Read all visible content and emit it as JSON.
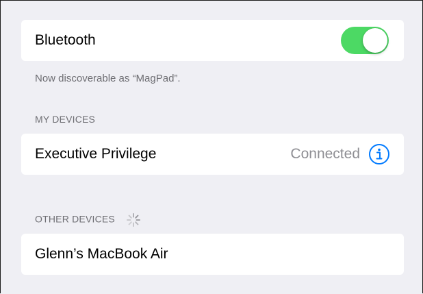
{
  "bluetooth": {
    "label": "Bluetooth",
    "enabled": true,
    "discoverable_note": "Now discoverable as “MagPad”."
  },
  "my_devices": {
    "header": "MY DEVICES",
    "items": [
      {
        "name": "Executive Privilege",
        "status": "Connected",
        "icon": "info-icon"
      }
    ]
  },
  "other_devices": {
    "header": "OTHER DEVICES",
    "loading_icon": "spinner-icon",
    "items": [
      {
        "name": "Glenn’s MacBook Air"
      }
    ]
  },
  "colors": {
    "toggle_on": "#4cd964",
    "accent": "#007aff",
    "background": "#efeff4",
    "secondary_text": "#6d6d72"
  }
}
